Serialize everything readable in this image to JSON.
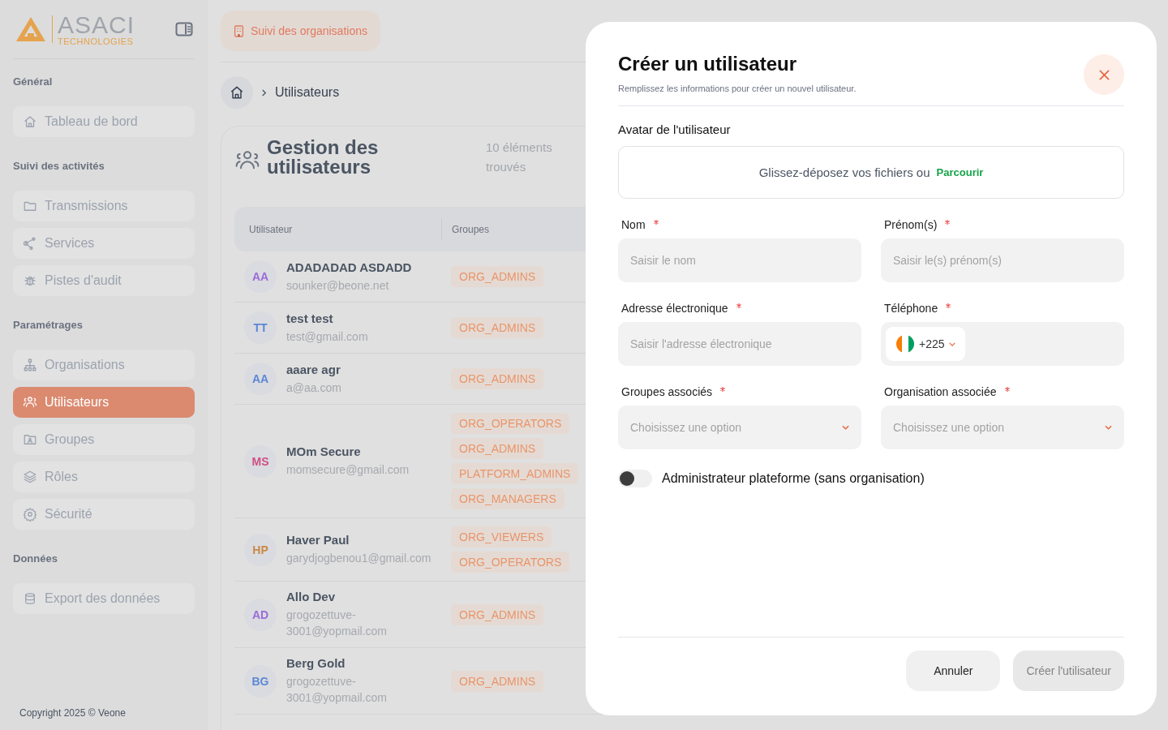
{
  "sidebar": {
    "logo": {
      "name": "ASACI",
      "tagline": "TECHNOLOGIES"
    },
    "sections": [
      {
        "title": "Général",
        "items": [
          {
            "label": "Tableau de bord",
            "kind": "home",
            "selected": false
          }
        ]
      },
      {
        "title": "Suivi des activités",
        "items": [
          {
            "label": "Transmissions",
            "kind": "folder",
            "selected": false
          },
          {
            "label": "Services",
            "kind": "share",
            "selected": false
          },
          {
            "label": "Pistes d'audit",
            "kind": "bug",
            "selected": false
          }
        ]
      },
      {
        "title": "Paramétrages",
        "items": [
          {
            "label": "Organisations",
            "kind": "sitemap",
            "selected": false
          },
          {
            "label": "Utilisateurs",
            "kind": "users",
            "selected": true
          },
          {
            "label": "Groupes",
            "kind": "folder-user",
            "selected": false
          },
          {
            "label": "Rôles",
            "kind": "layers",
            "selected": false
          },
          {
            "label": "Sécurité",
            "kind": "gear",
            "selected": false
          }
        ]
      },
      {
        "title": "Données",
        "items": [
          {
            "label": "Export des données",
            "kind": "database",
            "selected": false
          }
        ]
      }
    ],
    "copyright": "Copyright 2025 © Veone"
  },
  "header": {
    "module_button": "Suivi des organisations"
  },
  "breadcrumb": {
    "current": "Utilisateurs"
  },
  "page": {
    "title": "Gestion des utilisateurs",
    "count": "10 éléments trouvés"
  },
  "table": {
    "columns": [
      "Utilisateur",
      "Groupes"
    ],
    "rows": [
      {
        "initials": "AA",
        "color": "#9a6bd8",
        "name": "ADADADAD ASDADD",
        "email": "sounker@beone.net",
        "groups": [
          "ORG_ADMINS"
        ]
      },
      {
        "initials": "TT",
        "color": "#5b86d6",
        "name": "test test",
        "email": "test@gmail.com",
        "groups": [
          "ORG_ADMINS"
        ]
      },
      {
        "initials": "AA",
        "color": "#5b86d6",
        "name": "aaare agr",
        "email": "a@aa.com",
        "groups": [
          "ORG_ADMINS"
        ]
      },
      {
        "initials": "MS",
        "color": "#cf4f86",
        "name": "MOm Secure",
        "email": "momsecure@gmail.com",
        "groups": [
          "ORG_OPERATORS",
          "ORG_ADMINS",
          "PLATFORM_ADMINS",
          "ORG_MANAGERS"
        ]
      },
      {
        "initials": "HP",
        "color": "#c98a45",
        "name": "Haver Paul",
        "email": "garydjogbenou1@gmail.com",
        "groups": [
          "ORG_VIEWERS",
          "ORG_OPERATORS"
        ]
      },
      {
        "initials": "AD",
        "color": "#9a6bd8",
        "name": "Allo Dev",
        "email": "grogozettuve-3001@yopmail.com",
        "groups": [
          "ORG_ADMINS"
        ]
      },
      {
        "initials": "BG",
        "color": "#5b86d6",
        "name": "Berg Gold",
        "email": "grogozettuve-3001@yopmail.com",
        "groups": [
          "ORG_ADMINS"
        ]
      }
    ]
  },
  "modal": {
    "title": "Créer un utilisateur",
    "subtitle": "Remplissez les informations pour créer un nouvel utilisateur.",
    "avatar": {
      "label": "Avatar de l'utilisateur",
      "hint": "Glissez-déposez vos fichiers ou",
      "link": "Parcourir"
    },
    "fields": [
      {
        "kind": "text",
        "label": "Nom",
        "required": true,
        "placeholder": "Saisir le nom"
      },
      {
        "kind": "text",
        "label": "Prénom(s)",
        "required": true,
        "placeholder": "Saisir le(s) prénom(s)"
      },
      {
        "kind": "text",
        "label": "Adresse électronique",
        "required": true,
        "placeholder": "Saisir l'adresse électronique"
      },
      {
        "kind": "phone",
        "label": "Téléphone",
        "required": true,
        "dial_code": "+225"
      },
      {
        "kind": "select",
        "label": "Groupes associés",
        "required": true,
        "placeholder": "Choisissez une option"
      },
      {
        "kind": "select",
        "label": "Organisation associée",
        "required": true,
        "placeholder": "Choisissez une option"
      }
    ],
    "toggle": {
      "label": "Administrateur plateforme (sans organisation)",
      "on": false
    },
    "buttons": [
      {
        "kind": "cancel",
        "label": "Annuler",
        "disabled": false
      },
      {
        "kind": "submit",
        "label": "Créer l'utilisateur",
        "disabled": true
      }
    ]
  }
}
